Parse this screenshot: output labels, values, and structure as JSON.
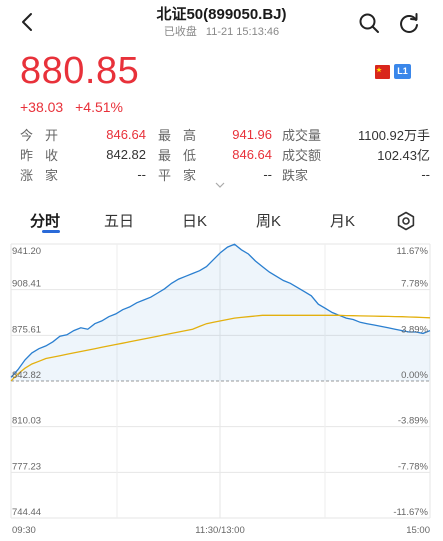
{
  "header": {
    "title": "北证50(899050.BJ)",
    "status": "已收盘",
    "datetime": "11-21 15:13:46"
  },
  "quote": {
    "price": "880.85",
    "change": "+38.03",
    "change_pct": "+4.51%",
    "badge": "L1",
    "accent_color": "#e8313a"
  },
  "stats": {
    "rows": [
      {
        "l1": "今开",
        "v1": "846.64",
        "l2": "最高",
        "v2": "941.96",
        "l3": "成交量",
        "v3": "1100.92万手"
      },
      {
        "l1": "昨收",
        "v1": "842.82",
        "l2": "最低",
        "v2": "846.64",
        "l3": "成交额",
        "v3": "102.43亿"
      },
      {
        "l1": "涨家",
        "v1": "--",
        "l2": "平家",
        "v2": "--",
        "l3": "跌家",
        "v3": "--"
      }
    ]
  },
  "tabs": [
    "分时",
    "五日",
    "日K",
    "周K",
    "月K"
  ],
  "active_tab": "分时",
  "chart_data": {
    "type": "line",
    "y_left_ticks": [
      "941.20",
      "908.41",
      "875.61",
      "842.82",
      "810.03",
      "777.23",
      "744.44"
    ],
    "y_right_ticks": [
      "11.67%",
      "7.78%",
      "3.89%",
      "0.00%",
      "-3.89%",
      "-7.78%",
      "-11.67%"
    ],
    "x_ticks": [
      "09:30",
      "11:30/13:00",
      "15:00"
    ],
    "ylim": [
      744.44,
      941.2
    ],
    "prev_close": 842.82,
    "series": [
      {
        "color": "#2a7fd0",
        "values": [
          845.5,
          851,
          858,
          863,
          866,
          868,
          871,
          875,
          876,
          879,
          881,
          880,
          884,
          886,
          889,
          891,
          894,
          896,
          899,
          901,
          903,
          906,
          909,
          913,
          916,
          918,
          920,
          922,
          925,
          930,
          935,
          939,
          941,
          937,
          934,
          929,
          925,
          921,
          918,
          915,
          913,
          910,
          907,
          904,
          898,
          895,
          892,
          890,
          888,
          887,
          885,
          884,
          883,
          882,
          881,
          880,
          879,
          878,
          878,
          877,
          879
        ]
      },
      {
        "color": "#e3b00e",
        "values": [
          842.9,
          848,
          852,
          855,
          857,
          859,
          860,
          861,
          862,
          863,
          864,
          865,
          866,
          867,
          868,
          869,
          870,
          871,
          872,
          873,
          874,
          875,
          876,
          877,
          878,
          879,
          880,
          882,
          884,
          885,
          886,
          887,
          888,
          888.5,
          889,
          889.5,
          890,
          890,
          890,
          890,
          890,
          890,
          890,
          890,
          890,
          890,
          890,
          890,
          889.8,
          889.7,
          889.6,
          889.5,
          889.4,
          889.3,
          889.2,
          889.1,
          889,
          888.8,
          888.6,
          888.4,
          888.2
        ]
      }
    ]
  }
}
